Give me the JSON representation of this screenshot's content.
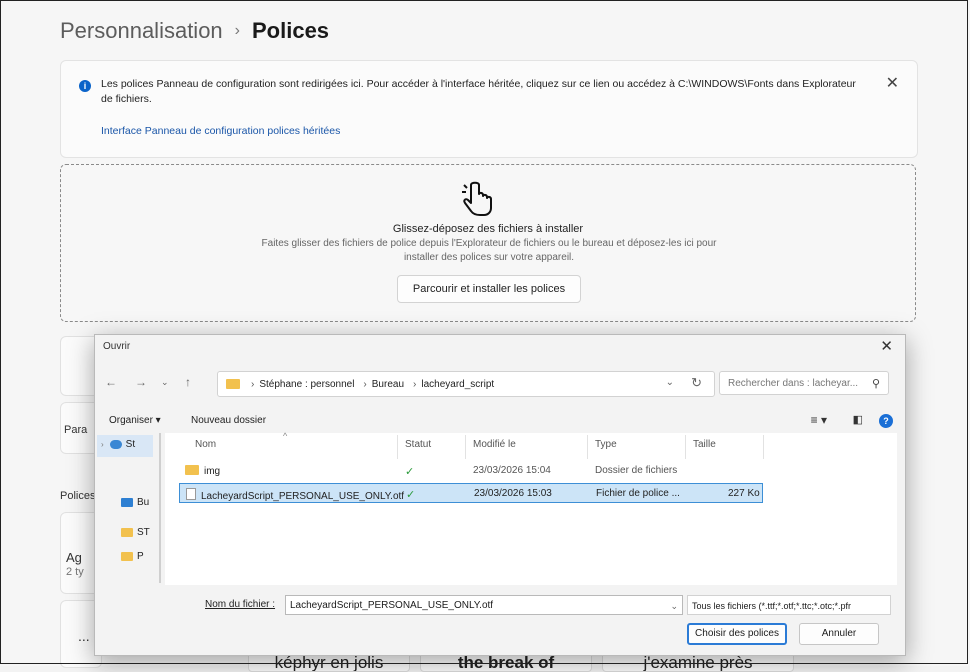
{
  "breadcrumb": {
    "parent": "Personnalisation",
    "separator": "›",
    "current": "Polices"
  },
  "info": {
    "icon": "info-icon",
    "text": "Les polices Panneau de configuration sont redirigées ici. Pour accéder à l'interface héritée, cliquez sur ce lien ou accédez à C:\\WINDOWS\\Fonts dans Explorateur de fichiers.",
    "link": "Interface Panneau de configuration polices héritées",
    "close": "✕"
  },
  "dropzone": {
    "icon": "hand-pointer-icon",
    "title": "Glissez-déposez des fichiers à installer",
    "description": "Faites glisser des fichiers de police depuis l'Explorateur de fichiers ou le bureau et déposez-les ici pour installer des polices sur votre appareil.",
    "button": "Parcourir et installer les polices"
  },
  "background": {
    "polices_label": "Polices",
    "para_label": "Para",
    "ag_label": "Ag",
    "types_label": "2 ty",
    "more": "...",
    "samples": [
      "képhyr en jolis",
      "the break of",
      "j'examine près"
    ]
  },
  "dialog": {
    "title": "Ouvrir",
    "close": "✕",
    "address": [
      "Stéphane : personnel",
      "Bureau",
      "lacheyard_script"
    ],
    "search_placeholder": "Rechercher dans : lacheyar...",
    "toolbar": {
      "organize": "Organiser ▾",
      "new_folder": "Nouveau dossier"
    },
    "nav_items": [
      "St",
      "Bu",
      "ST",
      "P"
    ],
    "columns": [
      "Nom",
      "Statut",
      "Modifié le",
      "Type",
      "Taille"
    ],
    "files": [
      {
        "name": "img",
        "status": "✓",
        "modified": "23/03/2026 15:04",
        "type": "Dossier de fichiers",
        "size": "",
        "kind": "folder"
      },
      {
        "name": "LacheyardScript_PERSONAL_USE_ONLY.otf",
        "status": "✓",
        "modified": "23/03/2026 15:03",
        "type": "Fichier de police ...",
        "size": "227 Ko",
        "kind": "font"
      }
    ],
    "filename_label": "Nom du fichier :",
    "filename_value": "LacheyardScript_PERSONAL_USE_ONLY.otf",
    "filetype": "Tous les fichiers (*.ttf;*.otf;*.ttc;*.otc;*.pfr",
    "open_button": "Choisir des polices",
    "cancel_button": "Annuler"
  }
}
